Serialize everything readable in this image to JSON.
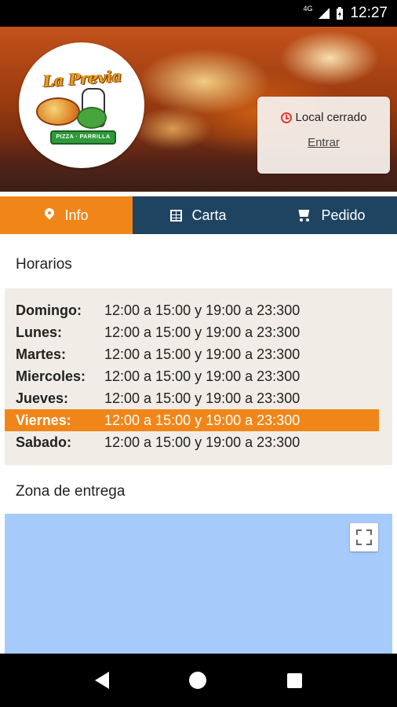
{
  "status_bar": {
    "network": "4G",
    "time": "12:27"
  },
  "header": {
    "logo_text": "La Previa",
    "logo_subtitle": "PIZZA · PARRILLA",
    "store_status": "Local cerrado",
    "enter_link": "Entrar"
  },
  "tabs": [
    {
      "label": "Info",
      "icon": "location-pin-icon",
      "active": true
    },
    {
      "label": "Carta",
      "icon": "menu-grid-icon",
      "active": false
    },
    {
      "label": "Pedido",
      "icon": "cart-icon",
      "active": false
    }
  ],
  "hours": {
    "title": "Horarios",
    "rows": [
      {
        "day": "Domingo:",
        "time": "12:00 a 15:00 y 19:00 a 23:300"
      },
      {
        "day": "Lunes:",
        "time": "12:00 a 15:00 y 19:00 a 23:300"
      },
      {
        "day": "Martes:",
        "time": "12:00 a 15:00 y 19:00 a 23:300"
      },
      {
        "day": "Miercoles:",
        "time": "12:00 a 15:00 y 19:00 a 23:300"
      },
      {
        "day": "Jueves:",
        "time": "12:00 a 15:00 y 19:00 a 23:300"
      },
      {
        "day": "Viernes:",
        "time": "12:00 a 15:00 y 19:00 a 23:300",
        "today": true
      },
      {
        "day": "Sabado:",
        "time": "12:00 a 15:00 y 19:00 a 23:300"
      }
    ]
  },
  "delivery": {
    "title": "Zona de entrega"
  },
  "colors": {
    "accent": "#f0861a",
    "tab_bar": "#1f4462",
    "map": "#a6cbfa"
  }
}
